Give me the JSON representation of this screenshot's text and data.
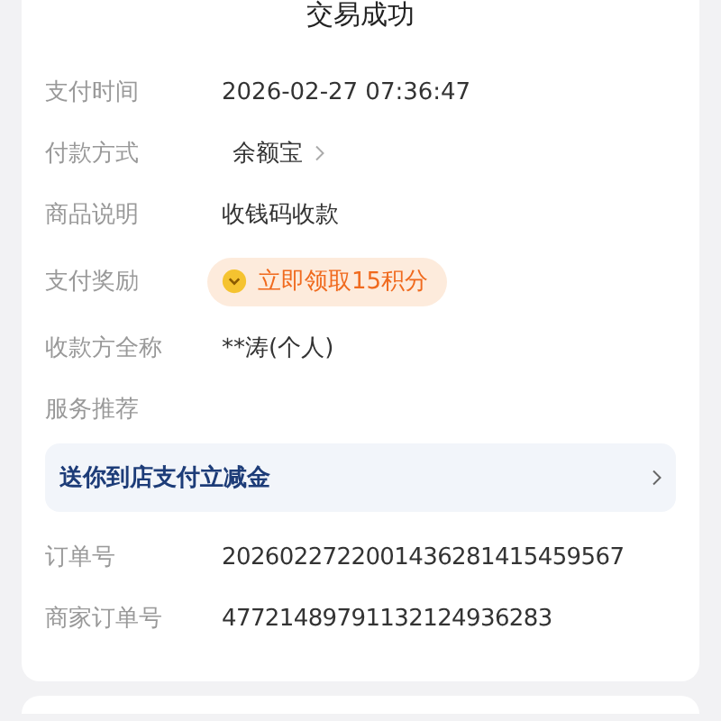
{
  "title": "交易成功",
  "details": [
    {
      "kind": "text",
      "label": "支付时间",
      "value": "2026-02-27 07:36:47"
    },
    {
      "kind": "link",
      "label": "付款方式",
      "value": "余额宝"
    },
    {
      "kind": "text",
      "label": "商品说明",
      "value": "收钱码收款"
    },
    {
      "kind": "reward",
      "label": "支付奖励",
      "value": "立即领取15积分"
    },
    {
      "kind": "text",
      "label": "收款方全称",
      "value": "**涛(个人)"
    },
    {
      "kind": "heading",
      "label": "服务推荐"
    }
  ],
  "banner": {
    "text": "送你到店支付立减金"
  },
  "orders": [
    {
      "label": "订单号",
      "value": "2026022722001436281415459567"
    },
    {
      "label": "商家订单号",
      "value": "47721489791132124936283"
    }
  ]
}
